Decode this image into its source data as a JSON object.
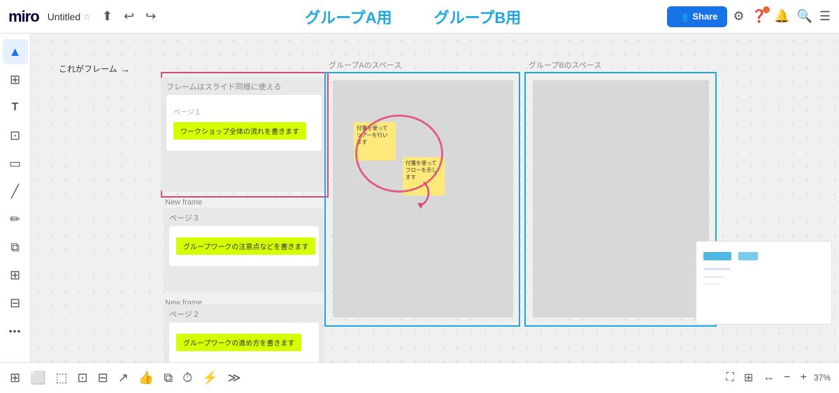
{
  "topnav": {
    "logo": "miro",
    "title": "Untitled",
    "share_label": "Share",
    "undo_icon": "↩",
    "redo_icon": "↪",
    "share_icon": "👥"
  },
  "header": {
    "group_a_label": "グループA用",
    "group_b_label": "グループB用"
  },
  "canvas": {
    "annotation_text": "これがフレーム",
    "pink_frame_content_label": "フレームはスライド同様に使える",
    "page1_label": "ページ１",
    "page1_sticky": "ワークショップ全体の流れを書きます",
    "new_frame1_label": "New frame",
    "page3_label": "ページ３",
    "page3_sticky": "グループワークの注意点などを書きます",
    "new_frame2_label": "New frame",
    "page2_label": "ページ２",
    "page2_sticky": "グループワークの進め方を書きます",
    "group_a_space_label": "グループAのスペース",
    "group_b_space_label": "グループBのスペース",
    "sticky1_text": "付箋を使ってツアーを行います",
    "sticky2_text": "付箋を使ってフローを示します"
  },
  "bottombar": {
    "zoom_level": "37%",
    "plus_label": "+",
    "minus_label": "−"
  },
  "sidebar": {
    "tools": [
      "cursor",
      "grid",
      "text",
      "crop",
      "rect",
      "line",
      "pen",
      "copy",
      "plus",
      "minus",
      "more"
    ]
  }
}
